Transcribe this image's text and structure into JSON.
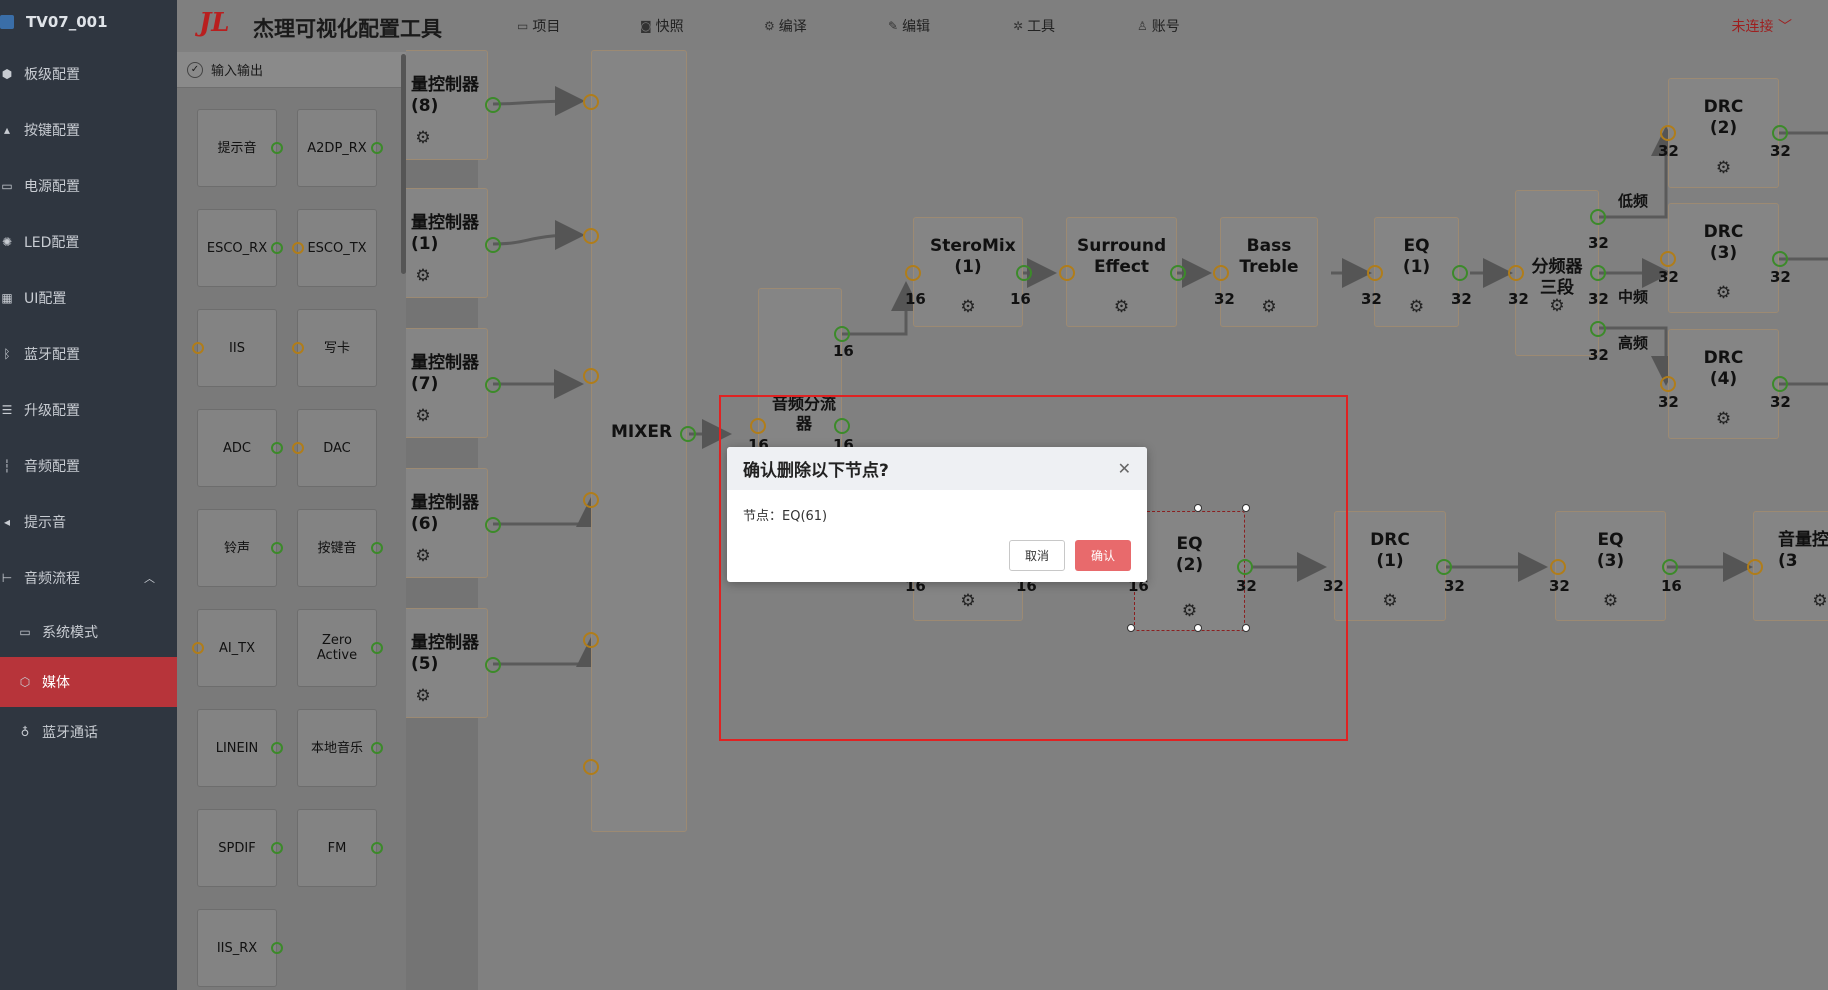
{
  "sidebar": {
    "project": "TV07_001",
    "items": [
      {
        "label": "板级配置",
        "icon": "cube-icon"
      },
      {
        "label": "按键配置",
        "icon": "sliders-icon"
      },
      {
        "label": "电源配置",
        "icon": "battery-icon"
      },
      {
        "label": "LED配置",
        "icon": "bulb-icon"
      },
      {
        "label": "UI配置",
        "icon": "grid-icon"
      },
      {
        "label": "蓝牙配置",
        "icon": "bluetooth-icon"
      },
      {
        "label": "升级配置",
        "icon": "list-icon"
      },
      {
        "label": "音频配置",
        "icon": "waveform-icon"
      },
      {
        "label": "提示音",
        "icon": "speaker-icon"
      },
      {
        "label": "音频流程",
        "icon": "flow-icon"
      }
    ],
    "sub_items": [
      {
        "label": "系统模式",
        "icon": "monitor-icon"
      },
      {
        "label": "媒体",
        "icon": "box-icon"
      },
      {
        "label": "蓝牙通话",
        "icon": "mic-icon"
      }
    ]
  },
  "header": {
    "logo": "JL",
    "title": "杰理可视化配置工具",
    "menu": [
      {
        "label": "项目",
        "icon": "folder-icon"
      },
      {
        "label": "快照",
        "icon": "camera-icon"
      },
      {
        "label": "编译",
        "icon": "compile-icon"
      },
      {
        "label": "编辑",
        "icon": "pen-icon"
      },
      {
        "label": "工具",
        "icon": "tool-icon"
      },
      {
        "label": "账号",
        "icon": "user-icon"
      }
    ],
    "connection": "未连接"
  },
  "palette": {
    "title": "输入输出",
    "cards": [
      "提示音",
      "A2DP_RX",
      "ESCO_RX",
      "ESCO_TX",
      "IIS",
      "写卡",
      "ADC",
      "DAC",
      "铃声",
      "按键音",
      "AI_TX",
      "Zero Active",
      "LINEIN",
      "本地音乐",
      "SPDIF",
      "FM",
      "IIS_RX"
    ]
  },
  "canvas": {
    "mixer_label": "MIXER",
    "ctrl_nodes": [
      {
        "name": "量控制器",
        "idx": "(8)"
      },
      {
        "name": "量控制器",
        "idx": "(1)"
      },
      {
        "name": "量控制器",
        "idx": "(7)"
      },
      {
        "name": "量控制器",
        "idx": "(6)"
      },
      {
        "name": "量控制器",
        "idx": "(5)"
      }
    ],
    "nodes": {
      "splitter": "音频分流器",
      "steromix": "SteroMix (1)",
      "surround": "Surround Effect",
      "bass": "Bass Treble",
      "eq1": "EQ (1)",
      "crossover": "分频器三段",
      "drc2": "DRC (2)",
      "drc3": "DRC (3)",
      "drc4": "DRC (4)",
      "eq2": "EQ (2)",
      "drc1": "DRC (1)",
      "eq3": "EQ (3)",
      "vol": "音量控 (3"
    },
    "band_labels": [
      "低频",
      "中频",
      "高频"
    ],
    "numbers": [
      "16",
      "16",
      "16",
      "16",
      "32",
      "32",
      "32",
      "32",
      "32",
      "32",
      "32",
      "32",
      "32",
      "32",
      "16",
      "16",
      "16",
      "16",
      "32",
      "32",
      "32",
      "32",
      "16",
      "32",
      "32",
      "32",
      "16"
    ]
  },
  "dialog": {
    "title": "确认删除以下节点?",
    "body": "节点：EQ(61)",
    "cancel": "取消",
    "confirm": "确认"
  },
  "colors": {
    "accent": "#b7343a",
    "port_green": "#3c8a2a",
    "port_orange": "#b07d1a",
    "selection": "#e02222"
  }
}
